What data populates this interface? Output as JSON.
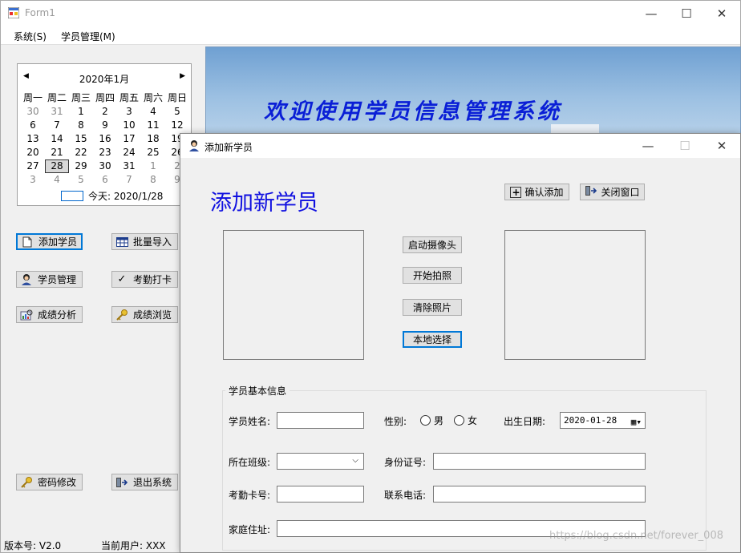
{
  "main": {
    "title": "Form1",
    "menu": [
      "系统(S)",
      "学员管理(M)"
    ]
  },
  "calendar": {
    "month_label": "2020年1月",
    "weekdays": [
      "周一",
      "周二",
      "周三",
      "周四",
      "周五",
      "周六",
      "周日"
    ],
    "weeks": [
      [
        "30",
        "31",
        "1",
        "2",
        "3",
        "4",
        "5"
      ],
      [
        "6",
        "7",
        "8",
        "9",
        "10",
        "11",
        "12"
      ],
      [
        "13",
        "14",
        "15",
        "16",
        "17",
        "18",
        "19"
      ],
      [
        "20",
        "21",
        "22",
        "23",
        "24",
        "25",
        "26"
      ],
      [
        "27",
        "28",
        "29",
        "30",
        "31",
        "1",
        "2"
      ],
      [
        "3",
        "4",
        "5",
        "6",
        "7",
        "8",
        "9"
      ]
    ],
    "selected": "28",
    "today_label": "今天: 2020/1/28"
  },
  "left_buttons": {
    "add_student": "添加学员",
    "batch_import": "批量导入",
    "student_manage": "学员管理",
    "attendance": "考勤打卡",
    "score_analysis": "成绩分析",
    "score_browse": "成绩浏览",
    "change_password": "密码修改",
    "exit_system": "退出系统"
  },
  "status": {
    "version": "版本号: V2.0",
    "user": "当前用户: XXX"
  },
  "banner": {
    "title": "欢迎使用学员信息管理系统"
  },
  "dialog": {
    "title": "添加新学员",
    "heading": "添加新学员",
    "confirm_add": "确认添加",
    "close_window": "关闭窗口",
    "start_camera": "启动摄像头",
    "take_photo": "开始拍照",
    "clear_photo": "清除照片",
    "local_select": "本地选择",
    "group_title": "学员基本信息",
    "name_label": "学员姓名:",
    "gender_label": "性别:",
    "male": "男",
    "female": "女",
    "birth_label": "出生日期:",
    "birth_value": "2020-01-28",
    "class_label": "所在班级:",
    "id_label": "身份证号:",
    "card_label": "考勤卡号:",
    "phone_label": "联系电话:",
    "address_label": "家庭住址:"
  },
  "watermark": "https://blog.csdn.net/forever_008"
}
